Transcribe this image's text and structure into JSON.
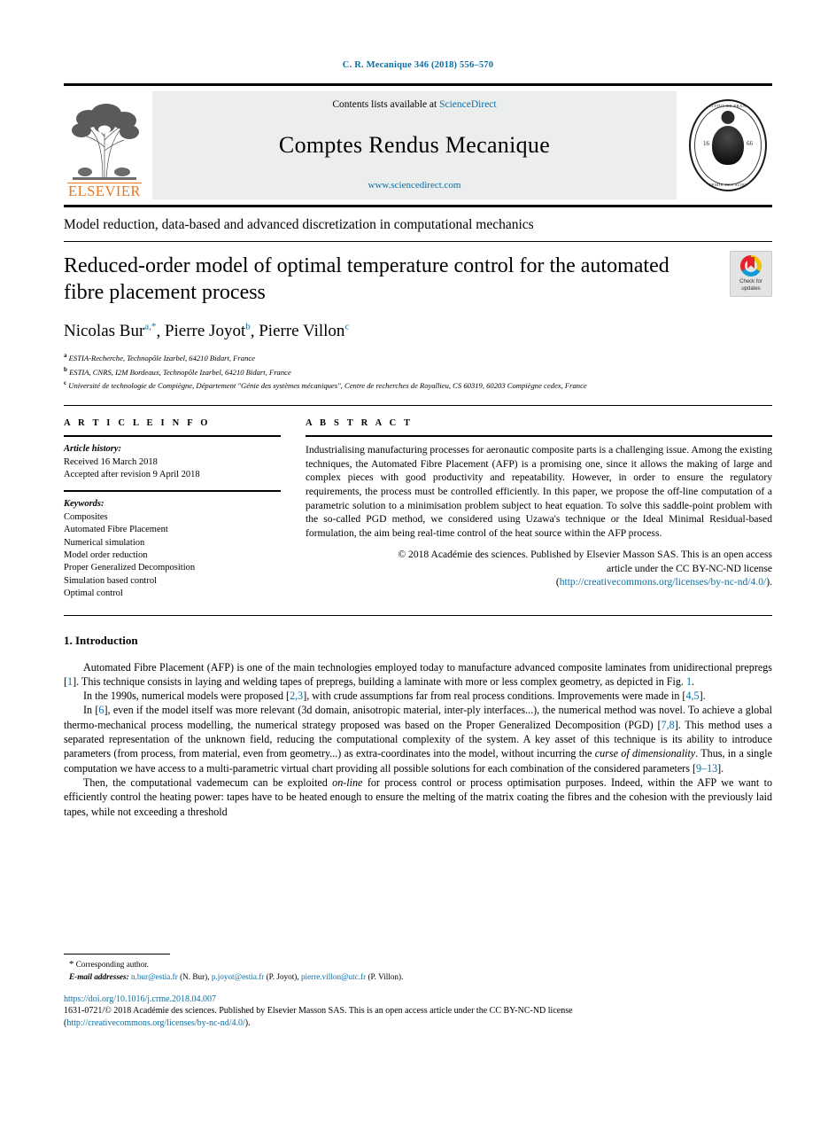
{
  "running_head": "C. R. Mecanique 346 (2018) 556–570",
  "masthead": {
    "publisher_name": "ELSEVIER",
    "contents_prefix": "Contents lists available at ",
    "contents_link": "ScienceDirect",
    "journal_title": "Comptes Rendus Mecanique",
    "sciencedirect_url": "www.sciencedirect.com",
    "seal_top_text": "INSTITUT DE FRANCE",
    "seal_bottom_text": "ACADEMIE DES SCIENCES",
    "seal_year_left": "16",
    "seal_year_right": "66",
    "accent_link_color": "#0b6fa4",
    "elsevier_orange": "#E87722"
  },
  "issue_section_title": "Model reduction, data-based and advanced discretization in computational mechanics",
  "article": {
    "title": "Reduced-order model of optimal temperature control for the automated fibre placement process",
    "crossmark_label": "Check for updates",
    "authors": [
      {
        "name": "Nicolas Bur",
        "marks": "a,*"
      },
      {
        "name": "Pierre Joyot",
        "marks": "b"
      },
      {
        "name": "Pierre Villon",
        "marks": "c"
      }
    ],
    "affiliations": [
      {
        "mark": "a",
        "text": "ESTIA-Recherche, Technopôle Izarbel, 64210 Bidart, France"
      },
      {
        "mark": "b",
        "text": "ESTIA, CNRS, I2M Bordeaux, Technopôle Izarbel, 64210 Bidart, France"
      },
      {
        "mark": "c",
        "text": "Université de technologie de Compiègne, Département \"Génie des systèmes mécaniques\", Centre de recherches de Royallieu, CS 60319, 60203 Compiègne cedex, France"
      }
    ]
  },
  "article_info": {
    "heading": "A R T I C L E   I N F O",
    "history_label": "Article history:",
    "received": "Received 16 March 2018",
    "accepted": "Accepted after revision 9 April 2018",
    "keywords_label": "Keywords:",
    "keywords": [
      "Composites",
      "Automated Fibre Placement",
      "Numerical simulation",
      "Model order reduction",
      "Proper Generalized Decomposition",
      "Simulation based control",
      "Optimal control"
    ]
  },
  "abstract": {
    "heading": "A B S T R A C T",
    "text": "Industrialising manufacturing processes for aeronautic composite parts is a challenging issue. Among the existing techniques, the Automated Fibre Placement (AFP) is a promising one, since it allows the making of large and complex pieces with good productivity and repeatability. However, in order to ensure the regulatory requirements, the process must be controlled efficiently. In this paper, we propose the off-line computation of a parametric solution to a minimisation problem subject to heat equation. To solve this saddle-point problem with the so-called PGD method, we considered using Uzawa's technique or the Ideal Minimal Residual-based formulation, the aim being real-time control of the heat source within the AFP process.",
    "copyright_line1": "© 2018 Académie des sciences. Published by Elsevier Masson SAS. This is an open access",
    "copyright_line2": "article under the CC BY-NC-ND license",
    "license_url_open": "(",
    "license_url": "http://creativecommons.org/licenses/by-nc-nd/4.0/",
    "license_url_close": ")."
  },
  "introduction": {
    "heading_number": "1.",
    "heading_text": "Introduction",
    "paragraphs": [
      {
        "parts": [
          {
            "t": "Automated Fibre Placement (AFP) is one of the main technologies employed today to manufacture advanced composite laminates from unidirectional prepregs ["
          },
          {
            "t": "1",
            "k": "cite"
          },
          {
            "t": "]. This technique consists in laying and welding tapes of prepregs, building a laminate with more or less complex geometry, as depicted in Fig. "
          },
          {
            "t": "1",
            "k": "cite"
          },
          {
            "t": "."
          }
        ]
      },
      {
        "parts": [
          {
            "t": "In the 1990s, numerical models were proposed ["
          },
          {
            "t": "2,3",
            "k": "cite"
          },
          {
            "t": "], with crude assumptions far from real process conditions. Improvements were made in ["
          },
          {
            "t": "4,5",
            "k": "cite"
          },
          {
            "t": "]."
          }
        ]
      },
      {
        "parts": [
          {
            "t": "In ["
          },
          {
            "t": "6",
            "k": "cite"
          },
          {
            "t": "], even if the model itself was more relevant (3d domain, anisotropic material, inter-ply interfaces...), the numerical method was novel. To achieve a global thermo-mechanical process modelling, the numerical strategy proposed was based on the Proper Generalized Decomposition (PGD) ["
          },
          {
            "t": "7,8",
            "k": "cite"
          },
          {
            "t": "]. This method uses a separated representation of the unknown field, reducing the computational complexity of the system. A key asset of this technique is its ability to introduce parameters (from process, from material, even from geometry...) as extra-coordinates into the model, without incurring the "
          },
          {
            "t": "curse of dimensionality",
            "k": "ital"
          },
          {
            "t": ". Thus, in a single computation we have access to a multi-parametric virtual chart providing all possible solutions for each combination of the considered parameters ["
          },
          {
            "t": "9–13",
            "k": "cite"
          },
          {
            "t": "]."
          }
        ]
      },
      {
        "parts": [
          {
            "t": "Then, the computational vademecum can be exploited "
          },
          {
            "t": "on-line",
            "k": "ital"
          },
          {
            "t": " for process control or process optimisation purposes. Indeed, within the AFP we want to efficiently control the heating power: tapes have to be heated enough to ensure the melting of the matrix coating the fibres and the cohesion with the previously laid tapes, while not exceeding a threshold"
          }
        ]
      }
    ]
  },
  "footer": {
    "corresponding_mark": "*",
    "corresponding_text": "Corresponding author.",
    "email_label": "E-mail addresses:",
    "emails": [
      {
        "address": "n.bur@estia.fr",
        "owner": "(N. Bur),"
      },
      {
        "address": "p.joyot@estia.fr",
        "owner": "(P. Joyot),"
      },
      {
        "address": "pierre.villon@utc.fr",
        "owner": "(P. Villon)."
      }
    ],
    "doi": "https://doi.org/10.1016/j.crme.2018.04.007",
    "copyright": "1631-0721/© 2018 Académie des sciences. Published by Elsevier Masson SAS. This is an open access article under the CC BY-NC-ND license",
    "license_open": "(",
    "license_url": "http://creativecommons.org/licenses/by-nc-nd/4.0/",
    "license_close": ")."
  }
}
